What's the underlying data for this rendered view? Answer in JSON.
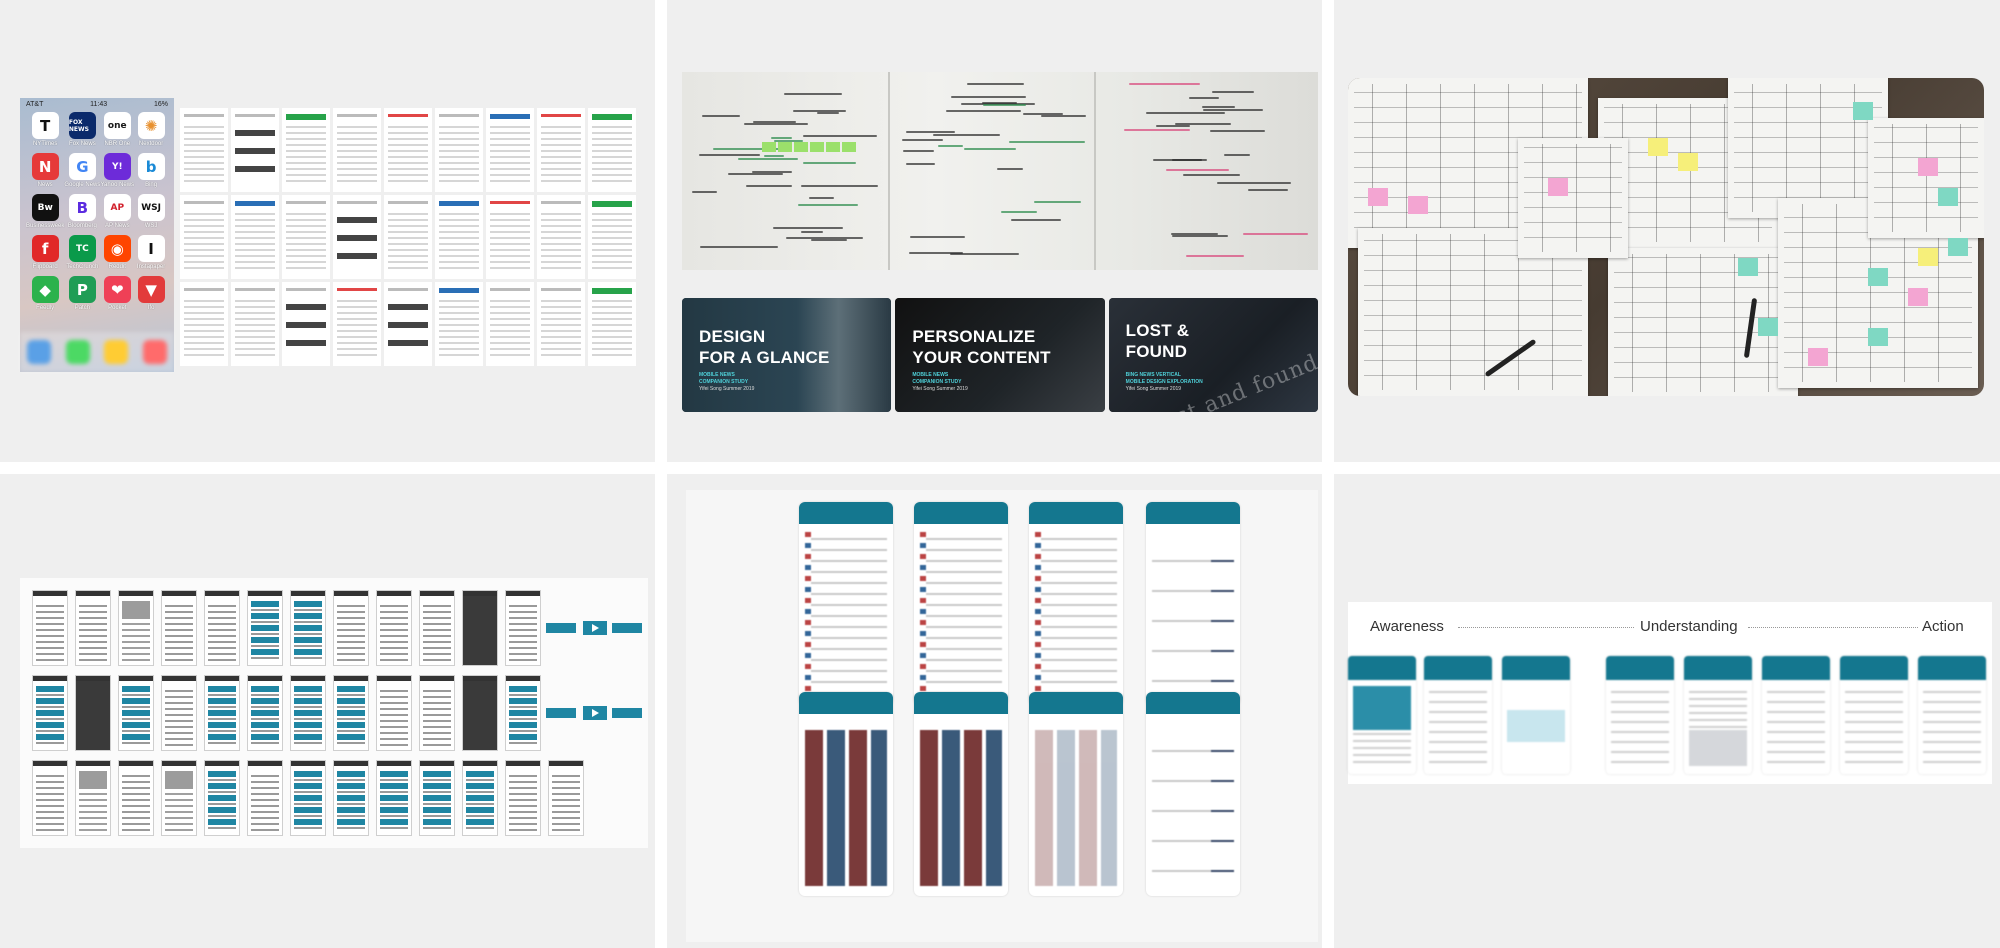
{
  "phone": {
    "status_carrier": "AT&T",
    "status_time": "11:43",
    "status_battery": "16%",
    "apps": [
      {
        "label": "NYTimes",
        "glyph": "T",
        "color": "#ffffff",
        "fg": "#111111"
      },
      {
        "label": "Fox News",
        "glyph": "FOX NEWS",
        "color": "#0b2a6b",
        "fg": "#ffffff"
      },
      {
        "label": "NBR One",
        "glyph": "one",
        "color": "#ffffff",
        "fg": "#1a1a1a"
      },
      {
        "label": "Nextdoor",
        "glyph": "✺",
        "color": "#ffffff",
        "fg": "#e8912f"
      },
      {
        "label": "News",
        "glyph": "N",
        "color": "#e63a3a",
        "fg": "#ffffff"
      },
      {
        "label": "Google News",
        "glyph": "G",
        "color": "#ffffff",
        "fg": "#4285f4"
      },
      {
        "label": "Yahoo News",
        "glyph": "Y!",
        "color": "#6d2bd9",
        "fg": "#ffffff"
      },
      {
        "label": "Bing",
        "glyph": "b",
        "color": "#ffffff",
        "fg": "#1a8ad6"
      },
      {
        "label": "Businessweek",
        "glyph": "Bw",
        "color": "#111111",
        "fg": "#ffffff"
      },
      {
        "label": "Bloomberg",
        "glyph": "B",
        "color": "#ffffff",
        "fg": "#5b2be0"
      },
      {
        "label": "AP News",
        "glyph": "AP",
        "color": "#ffffff",
        "fg": "#d11f2b"
      },
      {
        "label": "WSJ",
        "glyph": "WSJ",
        "color": "#ffffff",
        "fg": "#111111"
      },
      {
        "label": "Flipboard",
        "glyph": "f",
        "color": "#e12828",
        "fg": "#ffffff"
      },
      {
        "label": "TechCrunch",
        "glyph": "TC",
        "color": "#0a9a4a",
        "fg": "#ffffff"
      },
      {
        "label": "Reddit",
        "glyph": "◉",
        "color": "#ff4500",
        "fg": "#ffffff"
      },
      {
        "label": "Instapaper",
        "glyph": "I",
        "color": "#ffffff",
        "fg": "#111111"
      },
      {
        "label": "Feedly",
        "glyph": "◆",
        "color": "#2bb24c",
        "fg": "#ffffff"
      },
      {
        "label": "Patch",
        "glyph": "P",
        "color": "#1f9d55",
        "fg": "#ffffff"
      },
      {
        "label": "Pocket",
        "glyph": "❤",
        "color": "#ef4056",
        "fg": "#ffffff"
      },
      {
        "label": "Ifo",
        "glyph": "▼",
        "color": "#e23b3b",
        "fg": "#ffffff"
      }
    ]
  },
  "cards": [
    {
      "title": "DESIGN\nFOR A GLANCE",
      "sub_accent": "MOBILE NEWS\nCOMPANION STUDY",
      "sub_white": "Yifei Song Summer 2019"
    },
    {
      "title": "PERSONALIZE\nYOUR CONTENT",
      "sub_accent": "MOBILE NEWS\nCOMPANION STUDY",
      "sub_white": "Yifei Song Summer 2019"
    },
    {
      "title": "LOST &\nFOUND",
      "sub_accent": "BING NEWS VERTICAL\nMOBILE DESIGN EXPLORATION",
      "sub_white": "Yifei Song Summer 2019",
      "watermark": "Lost and found"
    }
  ],
  "journey": {
    "stages": [
      "Awareness",
      "Understanding",
      "Action"
    ]
  },
  "colors": {
    "tile_bg": "#efefef",
    "teal": "#14778f",
    "accent_cyan": "#4fd1d9"
  }
}
